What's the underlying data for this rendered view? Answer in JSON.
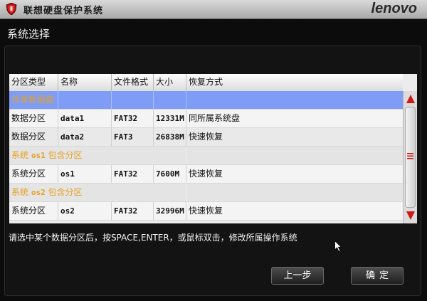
{
  "window": {
    "title": "联想硬盘保护系统",
    "brand": "lenovo"
  },
  "section_title": "系统选择",
  "table": {
    "headers": [
      "分区类型",
      "名称",
      "文件格式",
      "大小",
      "恢复方式"
    ],
    "rows": [
      {
        "kind": "group",
        "label_prefix": "共享数据盘",
        "label_name": "",
        "label_suffix": "",
        "selected": true
      },
      {
        "kind": "data",
        "type": "数据分区",
        "name": "data1",
        "format": "FAT32",
        "size": "12331M",
        "restore": "同所属系统盘"
      },
      {
        "kind": "data",
        "type": "数据分区",
        "name": "data2",
        "format": "FAT3",
        "size": "26838M",
        "restore": "快速恢复"
      },
      {
        "kind": "group",
        "label_prefix": "系统 ",
        "label_name": "os1",
        "label_suffix": " 包含分区",
        "selected": false
      },
      {
        "kind": "data",
        "type": "系统分区",
        "name": "os1",
        "format": "FAT32",
        "size": "7600M",
        "restore": "快速恢复"
      },
      {
        "kind": "group",
        "label_prefix": "系统 ",
        "label_name": "os2",
        "label_suffix": " 包含分区",
        "selected": false
      },
      {
        "kind": "data",
        "type": "系统分区",
        "name": "os2",
        "format": "FAT32",
        "size": "32996M",
        "restore": "快速恢复"
      }
    ]
  },
  "hint": "请选中某个数据分区后，按SPACE,ENTER，或鼠标双击，修改所属操作系统",
  "buttons": {
    "back": "上一步",
    "ok": "确定"
  },
  "colors": {
    "selected_row": "#7f9df7",
    "group_label": "#e8a020",
    "scroll_arrow": "#d01818"
  },
  "icons": [
    "app-shield-icon",
    "scroll-up-arrow-icon",
    "scroll-down-arrow-icon",
    "scroll-grip-icon",
    "mouse-cursor-icon"
  ]
}
